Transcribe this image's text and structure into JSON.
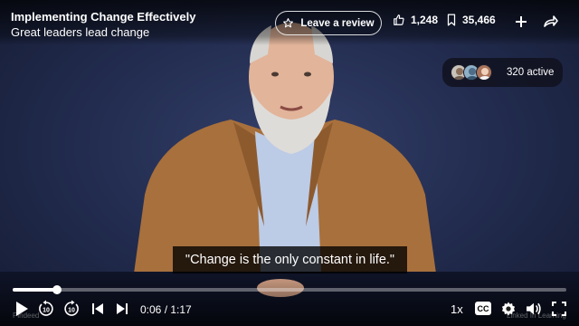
{
  "header": {
    "course_title": "Implementing Change Effectively",
    "chapter_title": "Great leaders lead change",
    "review_button_label": "Leave a review",
    "likes_count": "1,248",
    "saves_count": "35,466",
    "icons": [
      "star-icon",
      "thumbs-up-icon",
      "bookmark-icon",
      "plus-icon",
      "share-icon"
    ]
  },
  "viewers": {
    "count_label": "320 active"
  },
  "caption": {
    "text": "\"Change is the only constant in life.\""
  },
  "player": {
    "current_time": "0:06",
    "duration": "1:17",
    "time_label": "0:06 / 1:17",
    "progress_fraction": 0.08,
    "speed_label": "1x",
    "cc_label": "CC",
    "skip_back_seconds": "10",
    "skip_forward_seconds": "10",
    "watermark_left": "Pindeed",
    "watermark_right": "Linked In Learning"
  },
  "colors": {
    "background_top": "#34406a",
    "background_bottom": "#141b33",
    "jacket": "#a8703c",
    "shirt": "#bccbe6"
  }
}
